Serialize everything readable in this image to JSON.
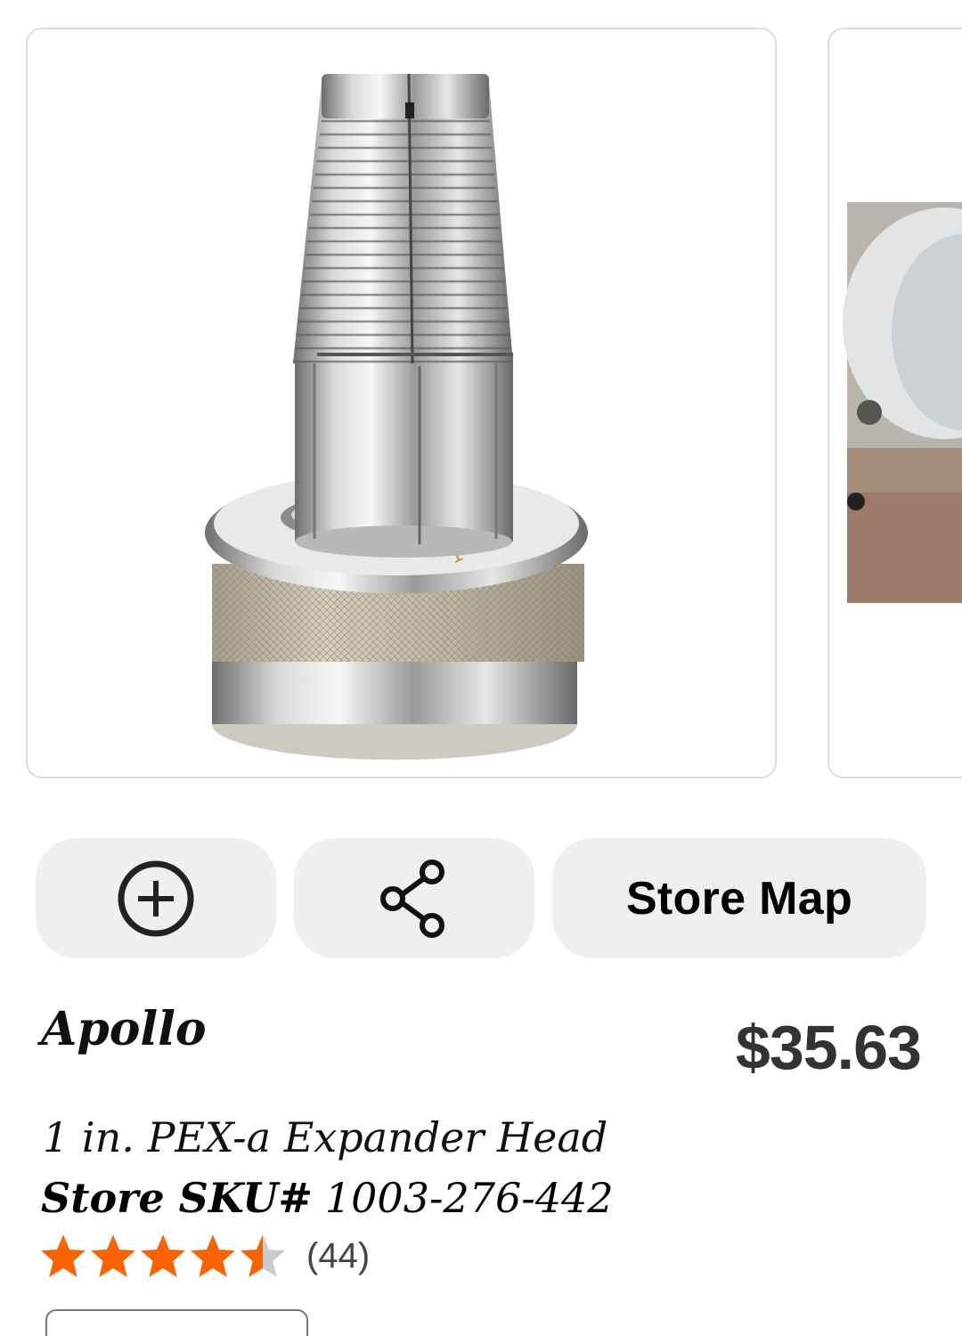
{
  "gallery": {
    "main_image": "chrome-expander-head-photo",
    "next_image": "expander-tool-photo"
  },
  "actions": {
    "add_icon": "plus-circle-icon",
    "share_icon": "share-icon",
    "store_map_label": "Store Map"
  },
  "product": {
    "brand": "Apollo",
    "price": "$35.63",
    "title": "1 in. PEX-a Expander Head",
    "sku_label": "Store SKU#",
    "sku_value": "1003-276-442",
    "rating": {
      "value": 4.5,
      "max": 5,
      "count_label": "(44)",
      "star_color": "#f96302",
      "empty_color": "#cccccc"
    }
  }
}
